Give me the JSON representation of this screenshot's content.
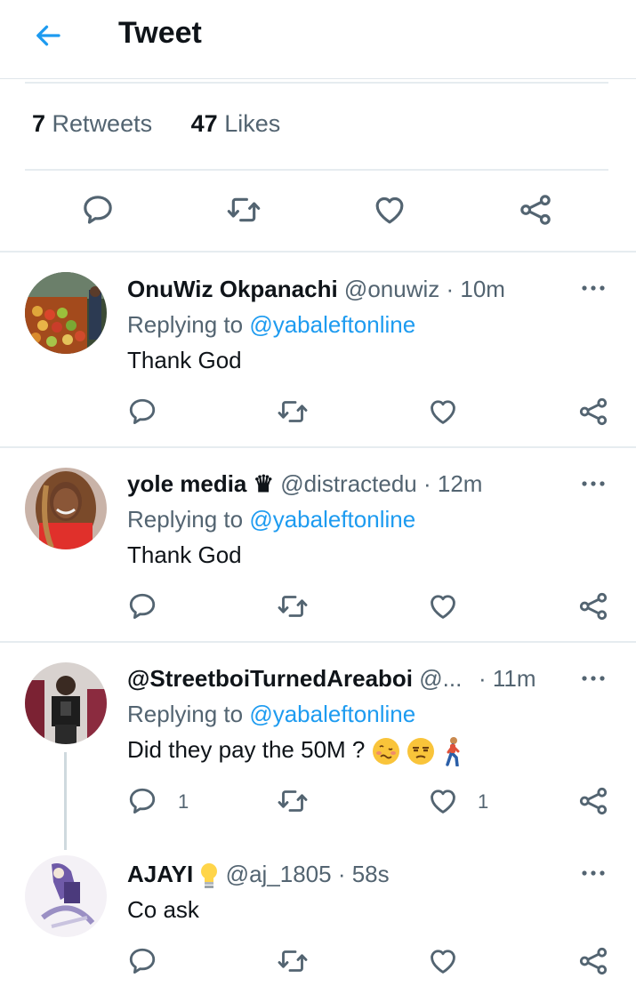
{
  "header": {
    "title": "Tweet",
    "back_icon": "arrow-left-icon"
  },
  "stats": {
    "retweets_count": "7",
    "retweets_label": "Retweets",
    "likes_count": "47",
    "likes_label": "Likes"
  },
  "main_actions": [
    "reply-icon",
    "retweet-icon",
    "like-icon",
    "share-icon"
  ],
  "colors": {
    "accent": "#1d9bf0",
    "muted": "#536471",
    "text": "#0f1419",
    "divider": "#e6ecf0"
  },
  "replies": [
    {
      "name": "OnuWiz Okpanachi",
      "handle": "@onuwiz",
      "time": "· 10m",
      "replying_prefix": "Replying to",
      "mention": "@yabaleftonline",
      "text": "Thank God",
      "reply_count": "",
      "like_count": ""
    },
    {
      "name": "yole media",
      "name_badge": "♛",
      "handle": "@distractedu",
      "time": "· 12m",
      "replying_prefix": "Replying to",
      "mention": "@yabaleftonline",
      "text": "Thank God",
      "reply_count": "",
      "like_count": ""
    },
    {
      "name": "@StreetboiTurnedAreaboi",
      "handle": "@...",
      "time": "· 11m",
      "replying_prefix": "Replying to",
      "mention": "@yabaleftonline",
      "text": "Did they pay the 50M ?",
      "emojis": [
        "woozy-face-emoji",
        "unamused-face-emoji",
        "person-walking-emoji"
      ],
      "reply_count": "1",
      "like_count": "1"
    },
    {
      "name": "AJAYI",
      "name_badge_icon": "light-bulb-emoji",
      "handle": "@aj_1805",
      "time": "· 58s",
      "text": "Co ask",
      "reply_count": "",
      "like_count": ""
    }
  ]
}
